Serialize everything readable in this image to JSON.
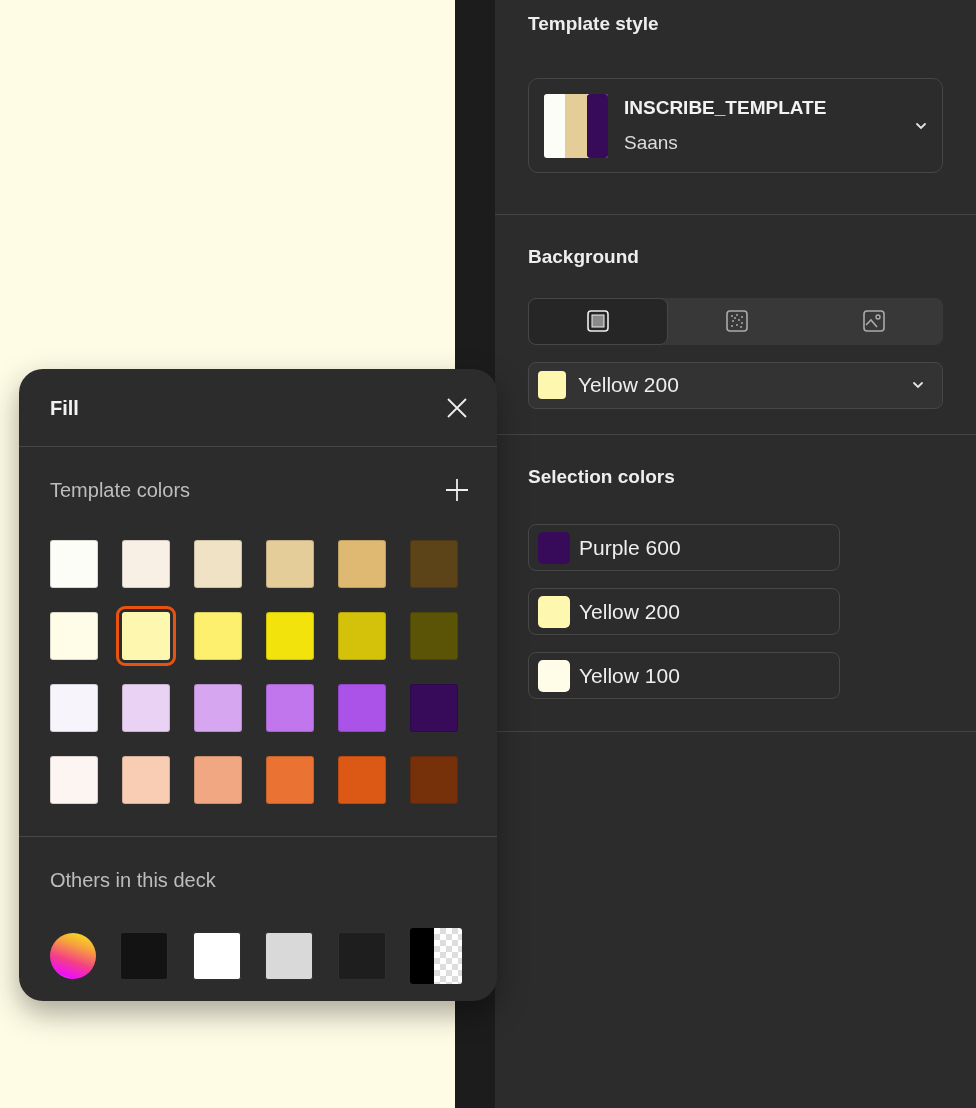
{
  "template_style": {
    "heading": "Template style",
    "name": "INSCRIBE_TEMPLATE",
    "font": "Saans"
  },
  "background": {
    "heading": "Background",
    "modes": [
      {
        "kind": "solid",
        "selected": true
      },
      {
        "kind": "pattern",
        "selected": false
      },
      {
        "kind": "image",
        "selected": false
      }
    ],
    "fill": {
      "label": "Yellow 200",
      "color": "#fef7b0"
    }
  },
  "selection_colors": {
    "heading": "Selection colors",
    "items": [
      {
        "label": "Purple 600",
        "color": "#370b5a"
      },
      {
        "label": "Yellow 200",
        "color": "#fef7b0"
      },
      {
        "label": "Yellow 100",
        "color": "#fffde8"
      }
    ]
  },
  "fill_popup": {
    "title": "Fill",
    "template_colors": {
      "heading": "Template colors",
      "rows": [
        [
          {
            "color": "#fdfdf8",
            "selected": false
          },
          {
            "color": "#f8f0e4",
            "selected": false
          },
          {
            "color": "#f0e2c4",
            "selected": false
          },
          {
            "color": "#e4cd98",
            "selected": false
          },
          {
            "color": "#dfb871",
            "selected": false
          },
          {
            "color": "#5c4418",
            "selected": false
          }
        ],
        [
          {
            "color": "#fffde8",
            "selected": false
          },
          {
            "color": "#fef7b0",
            "selected": true
          },
          {
            "color": "#fdf06f",
            "selected": false
          },
          {
            "color": "#f2e30c",
            "selected": false
          },
          {
            "color": "#d4c109",
            "selected": false
          },
          {
            "color": "#5b5406",
            "selected": false
          }
        ],
        [
          {
            "color": "#f8f4fc",
            "selected": false
          },
          {
            "color": "#ead2f5",
            "selected": false
          },
          {
            "color": "#d7a6f0",
            "selected": false
          },
          {
            "color": "#c176ed",
            "selected": false
          },
          {
            "color": "#ab52e8",
            "selected": false
          },
          {
            "color": "#370b5a",
            "selected": false
          }
        ],
        [
          {
            "color": "#fcf5f2",
            "selected": false
          },
          {
            "color": "#f9cdb4",
            "selected": false
          },
          {
            "color": "#f1a882",
            "selected": false
          },
          {
            "color": "#ea7232",
            "selected": false
          },
          {
            "color": "#dc5815",
            "selected": false
          },
          {
            "color": "#76310b",
            "selected": false
          }
        ]
      ]
    },
    "others": {
      "heading": "Others in this deck",
      "swatches": [
        {
          "kind": "gradient"
        },
        {
          "kind": "solid",
          "color": "#131314"
        },
        {
          "kind": "solid",
          "color": "#ffffff"
        },
        {
          "kind": "solid",
          "color": "#d9d9d9"
        },
        {
          "kind": "solid",
          "color": "#1e1e1e"
        },
        {
          "kind": "transparent",
          "color": "#000000"
        }
      ]
    }
  }
}
